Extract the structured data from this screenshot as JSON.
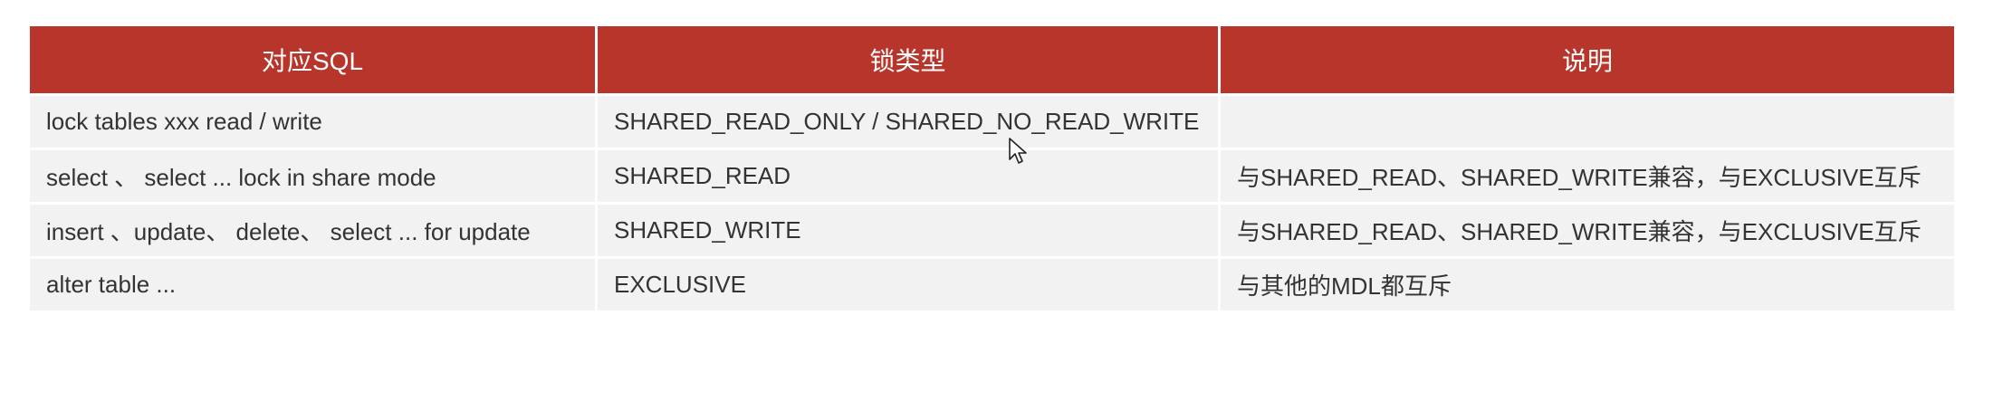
{
  "table": {
    "headers": [
      "对应SQL",
      "锁类型",
      "说明"
    ],
    "rows": [
      [
        "lock  tables  xxx  read / write",
        "SHARED_READ_ONLY / SHARED_NO_READ_WRITE",
        ""
      ],
      [
        "select 、 select ... lock in share mode",
        "SHARED_READ",
        "与SHARED_READ、SHARED_WRITE兼容，与EXCLUSIVE互斥"
      ],
      [
        "insert 、update、 delete、 select ... for  update",
        "SHARED_WRITE",
        "与SHARED_READ、SHARED_WRITE兼容，与EXCLUSIVE互斥"
      ],
      [
        "alter  table ...",
        "EXCLUSIVE",
        "与其他的MDL都互斥"
      ]
    ]
  },
  "colors": {
    "header_background": "#b8352b",
    "header_text": "#ffffff",
    "cell_background": "#f2f2f2",
    "cell_text": "#333333"
  },
  "icons": {
    "cursor": "mouse-pointer-icon"
  }
}
